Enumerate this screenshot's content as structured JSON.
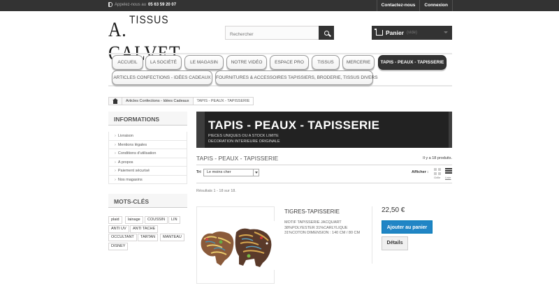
{
  "topbar": {
    "phone_label": "Appelez-nous au",
    "phone_number": "05 63 59 20 07",
    "links": [
      "Contactez-nous",
      "Connexion"
    ]
  },
  "logo": {
    "top": "TISSUS",
    "main": "A. CALVET"
  },
  "search": {
    "placeholder": "Rechercher"
  },
  "cart": {
    "label": "Panier",
    "status": "(vide)"
  },
  "menu": {
    "row1": [
      "Accueil",
      "La Société",
      "Le magasin",
      "Notre Vidéo",
      "Espace Pro",
      "Tissus",
      "Mercerie",
      "Tapis - Peaux - Tapisserie"
    ],
    "row2": [
      "Articles Confections - Idées Cadeaux",
      "Fournitures & Accessoires Tapissiers, Broderie, Tissus Divers"
    ]
  },
  "breadcrumb": {
    "items": [
      "Articles Confections - Idées Cadeaux",
      "TAPIS - PEAUX - TAPISSERIE"
    ]
  },
  "informations": {
    "title": "Informations",
    "items": [
      "Livraison",
      "Mentions légales",
      "Conditions d'utilisation",
      "A propos",
      "Paiement sécurisé",
      "Nos magasins"
    ]
  },
  "tags": {
    "title": "Mots-clés",
    "items": [
      "plaid",
      "lainage",
      "COUSSIN",
      "LIN",
      "ANTI UV",
      "ANTI TACHE",
      "OCCULTANT",
      "TARTAN",
      "MANTEAU",
      "DISNEY"
    ]
  },
  "category": {
    "banner_title": "TAPIS - PEAUX - TAPISSERIE",
    "banner_line1": "PIECES UNIQUES OU A STOCK LIMITE",
    "banner_line2": "DECORATION INTERIEURE ORIGINALE",
    "name": "TAPIS - PEAUX - TAPISSERIE",
    "count": "Il y a 18 produits."
  },
  "sort": {
    "label": "Tri",
    "value": "Le moins cher",
    "view_label": "Afficher :",
    "grid": "Grille",
    "list": "Liste"
  },
  "results": "Résultats 1 - 18 sur 18.",
  "product": {
    "name": "TIGRES-TAPISSERIE",
    "desc": "MOTIF TAPISSERIE JACQUART 38%POLYESTER 31%CARLYLIQUE 31%COTON DIMENSION : 140 CM / 80 CM",
    "price": "22,50 €",
    "add_to_cart": "Ajouter au panier",
    "details": "Détails"
  }
}
